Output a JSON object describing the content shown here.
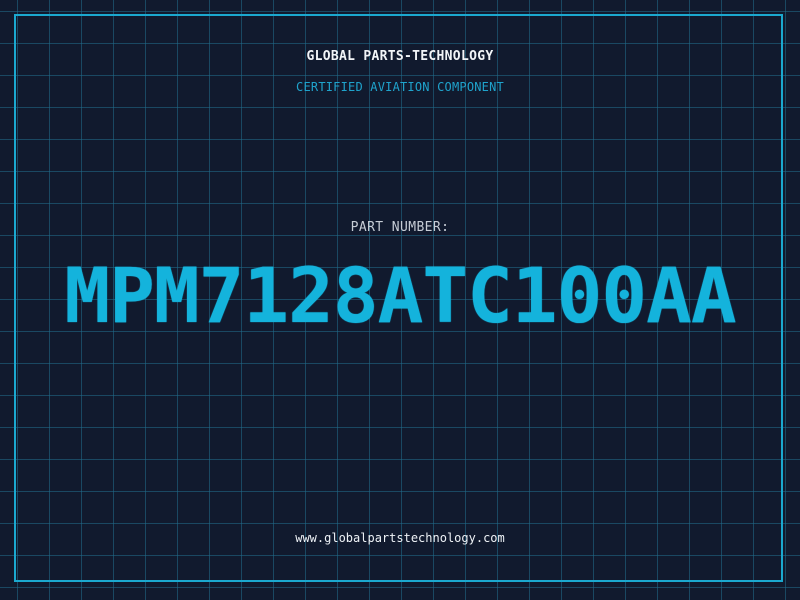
{
  "header": {
    "brand": "GLOBAL PARTS-TECHNOLOGY",
    "tagline": "CERTIFIED AVIATION COMPONENT"
  },
  "part": {
    "label": "PART NUMBER:",
    "number": "MPM7128ATC100AA"
  },
  "footer": {
    "website": "www.globalpartstechnology.com"
  },
  "colors": {
    "background": "#111a2e",
    "grid": "#206e8c",
    "accent": "#14b3dc",
    "frame": "#1ba9d0"
  }
}
